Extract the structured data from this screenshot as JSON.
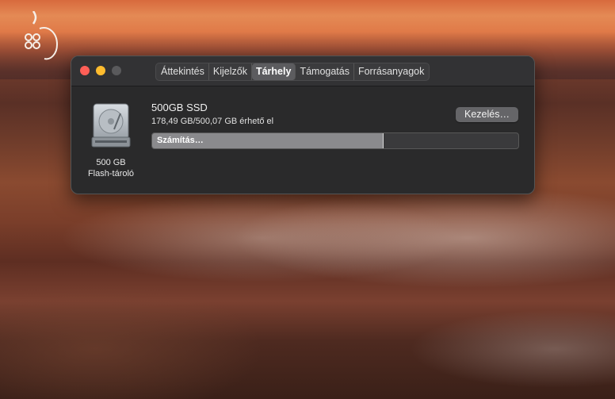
{
  "desktop": {
    "logo_icon": "apple-flower-logo-icon"
  },
  "window": {
    "tabs": [
      {
        "label": "Áttekintés"
      },
      {
        "label": "Kijelzők"
      },
      {
        "label": "Tárhely",
        "active": true
      },
      {
        "label": "Támogatás"
      },
      {
        "label": "Forrásanyagok"
      }
    ],
    "disk": {
      "icon": "hard-drive-icon",
      "capacity_label": "500 GB",
      "type_label": "Flash-tároló",
      "name": "500GB SSD",
      "available": "178,49 GB/500,07 GB érhető el",
      "manage_label": "Kezelés…",
      "bar_status": "Számítás…",
      "bar_fill_fraction": 0.63
    }
  },
  "colors": {
    "close": "#ff5f57",
    "minimize": "#febc2e",
    "zoom_disabled": "#5a5a5c"
  }
}
